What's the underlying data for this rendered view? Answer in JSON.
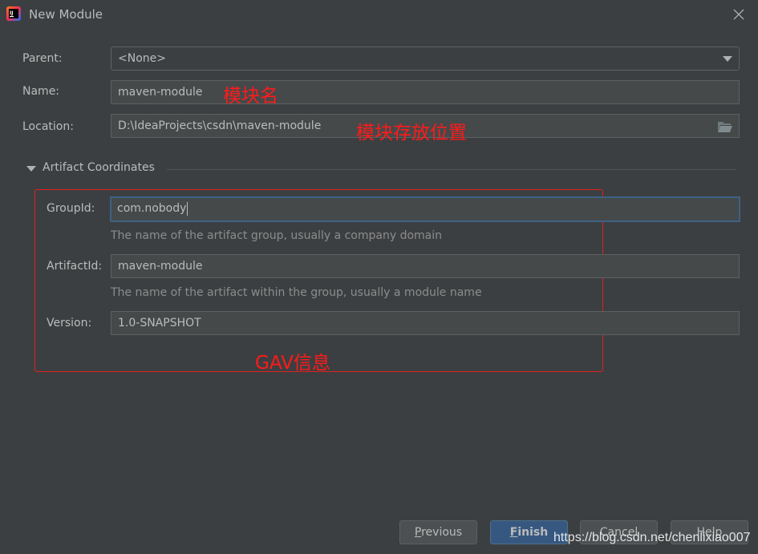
{
  "window": {
    "title": "New Module",
    "app_icon": "intellij-idea-icon",
    "close_icon": "close-icon"
  },
  "form": {
    "parent": {
      "label": "Parent:",
      "value": "<None>"
    },
    "name": {
      "label": "Name:",
      "value": "maven-module",
      "annotation": "模块名"
    },
    "location": {
      "label": "Location:",
      "value": "D:\\IdeaProjects\\csdn\\maven-module",
      "annotation": "模块存放位置"
    }
  },
  "artifact": {
    "section_title": "Artifact Coordinates",
    "group_id": {
      "label": "GroupId:",
      "value": "com.nobody",
      "hint": "The name of the artifact group, usually a company domain"
    },
    "artifact_id": {
      "label": "ArtifactId:",
      "value": "maven-module",
      "hint": "The name of the artifact within the group, usually a module name"
    },
    "version": {
      "label": "Version:",
      "value": "1.0-SNAPSHOT"
    },
    "annotation": "GAV信息"
  },
  "buttons": {
    "previous": {
      "mnemonic": "P",
      "rest": "revious"
    },
    "finish": {
      "mnemonic": "F",
      "rest": "inish"
    },
    "cancel": "Cancel",
    "help": "Help"
  },
  "watermark": "https://blog.csdn.net/chenlixiao007",
  "colors": {
    "background": "#3c3f41",
    "field_bg": "#45494a",
    "focus_border": "#3d6185",
    "primary_button": "#365880",
    "annotation_red": "#ff1a1a"
  }
}
